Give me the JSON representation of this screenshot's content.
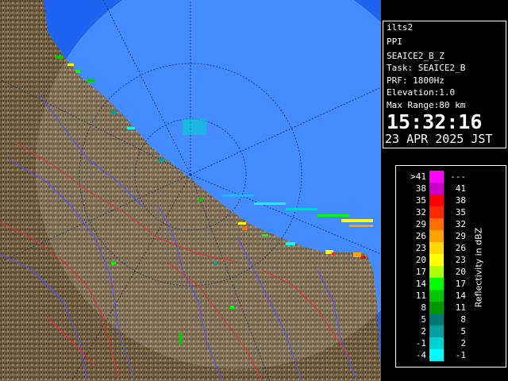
{
  "radar": {
    "site": "ilts2",
    "product": "PPI",
    "scan": "SEAICE2_B_Z",
    "task": "Task: SEAICE2_B",
    "prf": "PRF: 1800Hz",
    "elevation": "Elevation:1.0",
    "max_range": "Max Range:80 km",
    "time": "15:32:16",
    "date": "23 APR 2025 JST"
  },
  "legend": {
    "unit": "Reflectivity in dBZ",
    "rows": [
      {
        "lo": ">41",
        "hi": "---",
        "color": "#ff00ff"
      },
      {
        "lo": "38",
        "hi": "41",
        "color": "#c800c8"
      },
      {
        "lo": "35",
        "hi": "38",
        "color": "#ff0000"
      },
      {
        "lo": "32",
        "hi": "35",
        "color": "#ff2a00"
      },
      {
        "lo": "29",
        "hi": "32",
        "color": "#ff6e00"
      },
      {
        "lo": "26",
        "hi": "29",
        "color": "#ffa200"
      },
      {
        "lo": "23",
        "hi": "26",
        "color": "#ffd800"
      },
      {
        "lo": "20",
        "hi": "23",
        "color": "#ffff00"
      },
      {
        "lo": "17",
        "hi": "20",
        "color": "#aaff00"
      },
      {
        "lo": "14",
        "hi": "17",
        "color": "#00ff00"
      },
      {
        "lo": "11",
        "hi": "14",
        "color": "#00c800"
      },
      {
        "lo": "8",
        "hi": "11",
        "color": "#009600"
      },
      {
        "lo": "5",
        "hi": "8",
        "color": "#007878"
      },
      {
        "lo": "2",
        "hi": "5",
        "color": "#00a0a0"
      },
      {
        "lo": "-1",
        "hi": "2",
        "color": "#00d2d2"
      },
      {
        "lo": "-4",
        "hi": "-1",
        "color": "#00ffff"
      }
    ]
  },
  "colors": {
    "sea": "#1e64f0",
    "range_ring_fill": "#2a7cff",
    "land": "#6f5a3a",
    "river": "#5050ff",
    "border": "#e03030"
  }
}
